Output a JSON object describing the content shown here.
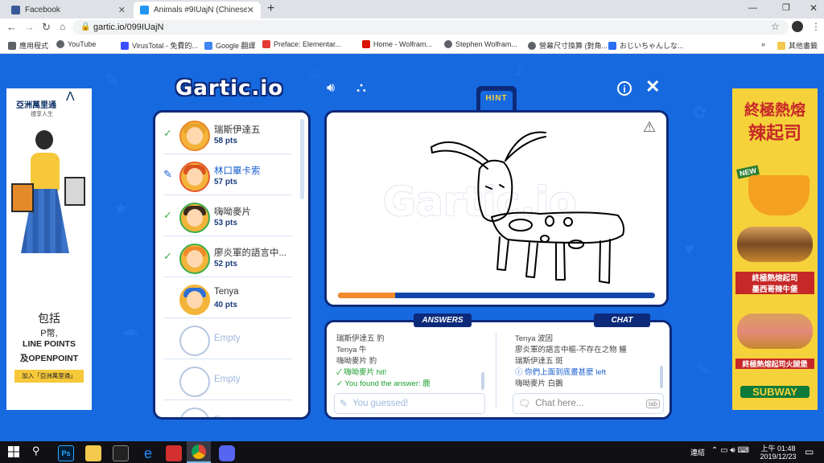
{
  "browser": {
    "tabs": [
      {
        "label": "Facebook",
        "color": "#3b5998"
      },
      {
        "label": "Animals #9IUajN (Chinese (Taiw",
        "color": "#2196f3"
      }
    ],
    "url": "gartic.io/099IUajN",
    "bookmarks": [
      {
        "label": "應用程式",
        "color": "#5f6368"
      },
      {
        "label": "YouTube",
        "color": "#5f6368"
      },
      {
        "label": "VirusTotal - 免費的...",
        "color": "#394eff"
      },
      {
        "label": "Google 翻譯",
        "color": "#4285f4"
      },
      {
        "label": "Preface: Elementar...",
        "color": "#e53935"
      },
      {
        "label": "Home - Wolfram...",
        "color": "#dd1100"
      },
      {
        "label": "Stephen Wolfram...",
        "color": "#5f6368"
      },
      {
        "label": "營幕尺寸換算 (對角...",
        "color": "#5f6368"
      },
      {
        "label": "おじいちゃんしな...",
        "color": "#2a6df4"
      }
    ],
    "other_bookmarks": "其他書籤",
    "more": "»"
  },
  "game": {
    "logo": "Gartic.io",
    "hint_label": "HINT",
    "hint_blank": "_",
    "watermark": "Gartic.io",
    "timer_progress": 0.18,
    "players": [
      {
        "name": "瑞斯伊達五",
        "pts": "58 pts",
        "status": "guessed",
        "hair": "#e8a12a",
        "ring": "#e8862a"
      },
      {
        "name": "林口畢卡索",
        "pts": "57 pts",
        "status": "drawing",
        "hair": "#d9531e",
        "ring": "#e85a30"
      },
      {
        "name": "嗨呦麥片",
        "pts": "53 pts",
        "status": "guessed",
        "hair": "#3b2a1e",
        "ring": "#3cae4b"
      },
      {
        "name": "廖炎軍的語言中...",
        "pts": "52 pts",
        "status": "guessed",
        "hair": "#f08a2a",
        "ring": "#3cae4b"
      },
      {
        "name": "Tenya",
        "pts": "40 pts",
        "status": "none",
        "hair": "#2d6fd6",
        "ring": "#f4b43a"
      }
    ],
    "empty_label": "Empty",
    "answers": {
      "title": "ANSWERS",
      "messages": [
        {
          "text": "瑞斯伊達五 豹",
          "cls": ""
        },
        {
          "text": "Tenya 牛",
          "cls": ""
        },
        {
          "text": "嗨呦麥片 豹",
          "cls": ""
        },
        {
          "text": "✓ 嗨呦麥片 hit!",
          "cls": "green"
        },
        {
          "text": "✓ You found the answer: 鹿",
          "cls": "green"
        }
      ],
      "placeholder": "You guessed!"
    },
    "chat": {
      "title": "CHAT",
      "messages": [
        {
          "text": "Tenya 波因",
          "cls": ""
        },
        {
          "text": "廖炎軍的語言中樞-不存在之物 鱷",
          "cls": ""
        },
        {
          "text": "瑞斯伊達五 斑",
          "cls": ""
        },
        {
          "text": "ⓘ 你們上面到底畫甚麼 left",
          "cls": "bluec"
        },
        {
          "text": "嗨呦麥片 白鵝",
          "cls": ""
        }
      ],
      "placeholder": "Chat here...",
      "tab_hint": "tab"
    }
  },
  "ads": {
    "left": {
      "brand": "亞洲萬里通",
      "tagline": "禮享人生",
      "line1": "包括",
      "line2": "P幣,",
      "line3": "LINE POINTS",
      "line4": "及OPENPOINT",
      "cta": "加入「亞洲萬里通」"
    },
    "right": {
      "title1": "終極熱熔",
      "title2": "辣起司",
      "badge": "NEW",
      "caption1": "終極熱熔起司",
      "caption2": "墨西哥辣牛堡",
      "caption3": "終極熱熔起司火腿堡",
      "brand": "SUBWAY"
    }
  },
  "taskbar": {
    "tray_label": "連結",
    "time": "上午 01:48",
    "date": "2019/12/23"
  }
}
